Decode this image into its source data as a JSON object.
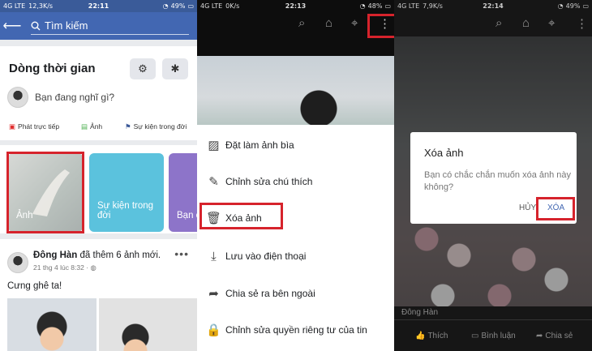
{
  "p1": {
    "status": {
      "left": "4G LTE",
      "signal": "ıll",
      "speed": "12,3K/s",
      "time": "22:11",
      "battery": "49%"
    },
    "search_placeholder": "Tìm kiếm",
    "timeline_title": "Dòng thời gian",
    "composer_prompt": "Bạn đang nghĩ gì?",
    "actions": [
      {
        "icon": "live-icon",
        "label": "Phát trực tiếp"
      },
      {
        "icon": "photo-icon",
        "label": "Ảnh"
      },
      {
        "icon": "flag-icon",
        "label": "Sự kiện trong đời"
      }
    ],
    "tiles": [
      "Ảnh",
      "Sự kiện trong đời",
      "Bạn c"
    ],
    "post": {
      "name": "Đông Hàn",
      "action": " đã thêm 6 ảnh mới.",
      "time": "21 thg 4 lúc 8:32 · ",
      "text": "Cưng ghê ta!"
    },
    "colors": {
      "header": "#4267b2",
      "highlight": "#d6232c"
    }
  },
  "p2": {
    "status": {
      "left": "4G LTE",
      "speed": "0K/s",
      "time": "22:13",
      "battery": "48%"
    },
    "menu": [
      {
        "icon": "photo-icon",
        "label": "Đặt làm ảnh bìa"
      },
      {
        "icon": "pencil-icon",
        "label": "Chỉnh sửa chú thích"
      },
      {
        "icon": "trash-icon",
        "label": "Xóa ảnh"
      },
      {
        "icon": "download-icon",
        "label": "Lưu vào điện thoại"
      },
      {
        "icon": "share-icon",
        "label": "Chia sẻ ra bên ngoài"
      },
      {
        "icon": "lock-icon",
        "label": "Chỉnh sửa quyền riêng tư của tin"
      }
    ]
  },
  "p3": {
    "status": {
      "left": "4G LTE",
      "speed": "7,9K/s",
      "time": "22:14",
      "battery": "49%"
    },
    "dialog": {
      "title": "Xóa ảnh",
      "message": "Bạn có chắc chắn muốn xóa ảnh này không?",
      "cancel": "HỦY",
      "confirm": "XÓA"
    },
    "caption": "Đông Hàn",
    "actions": [
      "Thích",
      "Bình luận",
      "Chia sẻ"
    ]
  }
}
